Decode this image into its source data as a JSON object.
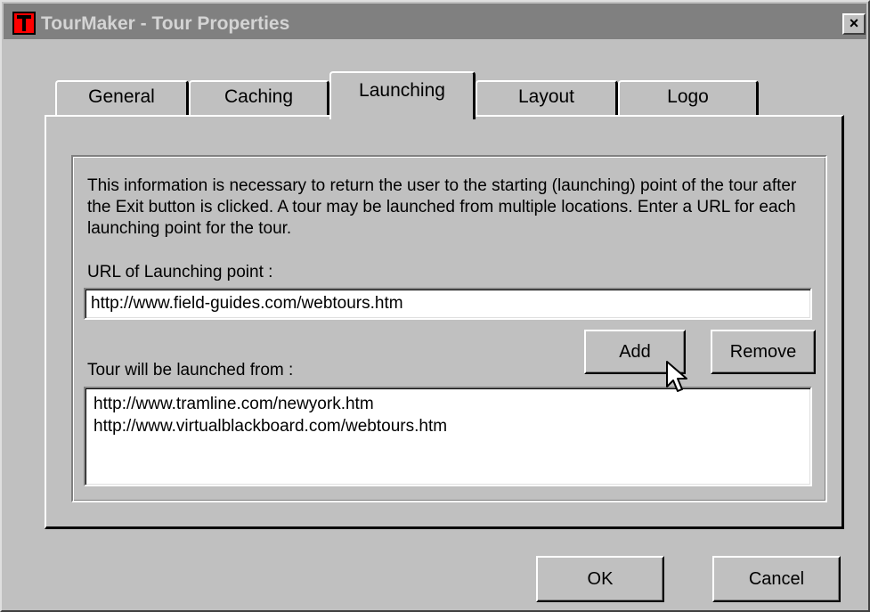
{
  "window": {
    "title": "TourMaker - Tour Properties",
    "close_label": "×"
  },
  "tabs": [
    {
      "label": "General",
      "active": false
    },
    {
      "label": "Caching",
      "active": false
    },
    {
      "label": "Launching",
      "active": true
    },
    {
      "label": "Layout",
      "active": false
    },
    {
      "label": "Logo",
      "active": false
    }
  ],
  "launching": {
    "info_text": "This information is necessary to return the user to the starting (launching) point of the tour after the Exit button is clicked. A tour may be launched from multiple locations. Enter a URL for each launching point for the tour.",
    "url_label": "URL of Launching point :",
    "url_value": "http://www.field-guides.com/webtours.htm",
    "add_label": "Add",
    "remove_label": "Remove",
    "launched_from_label": "Tour will be launched from :",
    "launched_from": [
      "http://www.tramline.com/newyork.htm",
      "http://www.virtualblackboard.com/webtours.htm"
    ]
  },
  "footer": {
    "ok_label": "OK",
    "cancel_label": "Cancel"
  },
  "colors": {
    "face": "#c0c0c0",
    "titlebar_inactive": "#808080",
    "title_text": "#d4d4d4",
    "icon_red": "#ff0000"
  }
}
